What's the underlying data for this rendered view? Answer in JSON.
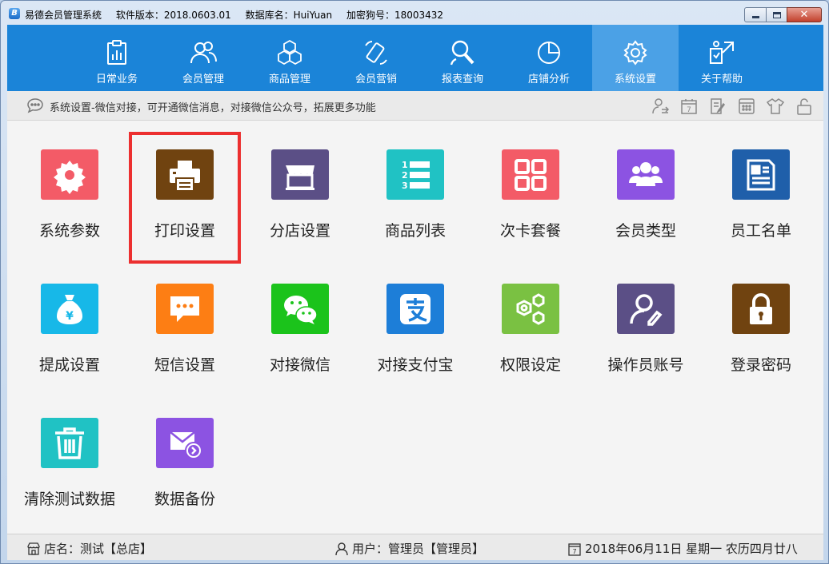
{
  "window": {
    "app_icon_letter": "B",
    "title": "易德会员管理系统",
    "version": "软件版本：2018.0603.01",
    "database": "数据库名：HuiYuan",
    "dongle": "加密狗号：18003432"
  },
  "nav": {
    "items": [
      {
        "label": "日常业务",
        "icon": "clipboard-chart-icon"
      },
      {
        "label": "会员管理",
        "icon": "users-icon"
      },
      {
        "label": "商品管理",
        "icon": "cubes-icon"
      },
      {
        "label": "会员营销",
        "icon": "phone-icon"
      },
      {
        "label": "报表查询",
        "icon": "search-person-icon"
      },
      {
        "label": "店铺分析",
        "icon": "pie-chart-icon"
      },
      {
        "label": "系统设置",
        "icon": "gear-icon",
        "active": true
      },
      {
        "label": "关于帮助",
        "icon": "help-icon"
      }
    ]
  },
  "infobar": {
    "text": "系统设置-微信对接，可开通微信消息，对接微信公众号，拓展更多功能"
  },
  "tiles": [
    {
      "label": "系统参数",
      "icon": "gear-icon",
      "color": "#f35b67"
    },
    {
      "label": "打印设置",
      "icon": "printer-icon",
      "color": "#704310",
      "highlighted": true
    },
    {
      "label": "分店设置",
      "icon": "store-icon",
      "color": "#5b4f86"
    },
    {
      "label": "商品列表",
      "icon": "numbered-list-icon",
      "color": "#20c2c4"
    },
    {
      "label": "次卡套餐",
      "icon": "grid-icon",
      "color": "#f35b67"
    },
    {
      "label": "会员类型",
      "icon": "users-icon",
      "color": "#8c53e2"
    },
    {
      "label": "员工名单",
      "icon": "id-card-icon",
      "color": "#1f5faa"
    },
    {
      "label": "提成设置",
      "icon": "money-bag-icon",
      "color": "#17b8e8"
    },
    {
      "label": "短信设置",
      "icon": "chat-bubble-icon",
      "color": "#fd7e14"
    },
    {
      "label": "对接微信",
      "icon": "wechat-icon",
      "color": "#1bc31b"
    },
    {
      "label": "对接支付宝",
      "icon": "alipay-icon",
      "color": "#1d7ed8"
    },
    {
      "label": "权限设定",
      "icon": "hexagon-gears-icon",
      "color": "#7ac142"
    },
    {
      "label": "操作员账号",
      "icon": "user-edit-icon",
      "color": "#5b4f86"
    },
    {
      "label": "登录密码",
      "icon": "lock-icon",
      "color": "#704310"
    },
    {
      "label": "清除测试数据",
      "icon": "trash-icon",
      "color": "#20c2c4"
    },
    {
      "label": "数据备份",
      "icon": "mail-arrow-icon",
      "color": "#8c53e2"
    }
  ],
  "status": {
    "store": "店名：测试【总店】",
    "user": "用户：管理员【管理员】",
    "date": "2018年06月11日 星期一 农历四月廿八",
    "calendar_day": "7"
  }
}
